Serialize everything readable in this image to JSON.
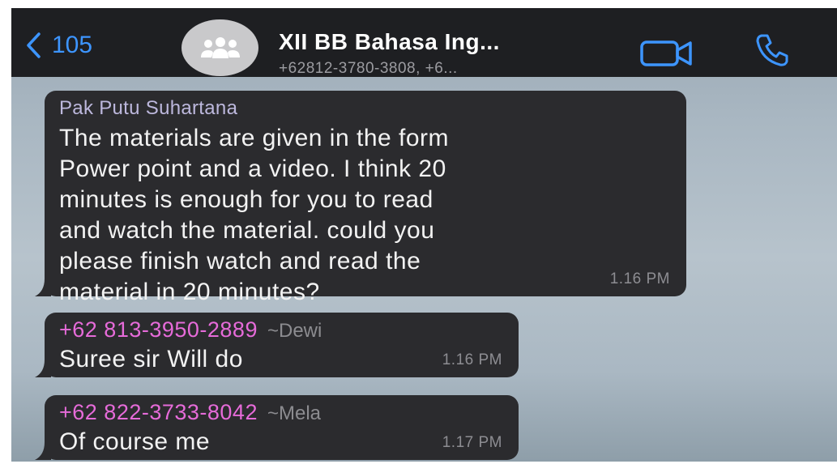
{
  "header": {
    "back_count": "105",
    "title": "XII BB Bahasa Ing...",
    "subtitle": "+62812-3780-3808, +6...",
    "icons": {
      "back": "chevron-left-icon",
      "avatar": "group-icon",
      "video": "video-camera-icon",
      "phone": "phone-icon"
    }
  },
  "messages": [
    {
      "sender_name": "Pak Putu Suhartana",
      "lines": [
        "The materials are given in the form",
        "Power point and a video. I think 20",
        "minutes is enough for you to read",
        "and watch the material. could you",
        "please finish watch and read the",
        "material in 20 minutes?"
      ],
      "time": "1.16 PM"
    },
    {
      "sender_phone": "+62 813-3950-2889",
      "sender_nick": "~Dewi",
      "lines": [
        "Suree sir Will do"
      ],
      "time": "1.16 PM"
    },
    {
      "sender_phone": "+62 822-3733-8042",
      "sender_nick": "~Mela",
      "lines": [
        "Of course me"
      ],
      "time": "1.17 PM"
    }
  ],
  "colors": {
    "accent": "#3d95ff",
    "bar_bg": "#1e1f22",
    "bubble_bg": "#2b2b2e",
    "name_purple": "#bdb8dd",
    "phone_pink": "#e66bd9"
  }
}
